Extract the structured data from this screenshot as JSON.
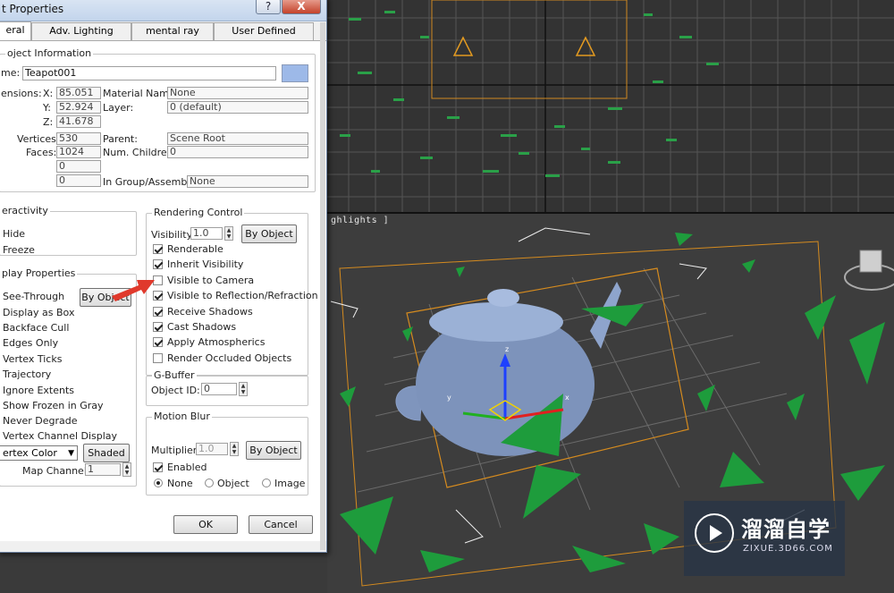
{
  "dialog": {
    "title": "t Properties",
    "help_btn": "?",
    "close_btn": "X",
    "tabs": [
      "eral",
      "Adv. Lighting",
      "mental ray",
      "User Defined"
    ],
    "object_info": {
      "group_title": "oject Information",
      "name_label": "me:",
      "name_value": "Teapot001",
      "color_swatch": "#9db9e8",
      "dimensions_label": "ensions:",
      "x_label": "X:",
      "x_value": "85.051",
      "y_label": "Y:",
      "y_value": "52.924",
      "z_label": "Z:",
      "z_value": "41.678",
      "vertices_label": "Vertices:",
      "vertices_value": "530",
      "faces_label": "Faces:",
      "faces_value": "1024",
      "extra1": "0",
      "extra2": "0",
      "material_name_label": "Material Name:",
      "material_name_value": "None",
      "layer_label": "Layer:",
      "layer_value": "0 (default)",
      "parent_label": "Parent:",
      "parent_value": "Scene Root",
      "num_children_label": "Num. Children:",
      "num_children_value": "0",
      "group_assembly_label": "In Group/Assembly:",
      "group_assembly_value": "None"
    },
    "interactivity": {
      "group_title": "eractivity",
      "hide": "Hide",
      "freeze": "Freeze"
    },
    "display_props": {
      "group_title": "play Properties",
      "items": [
        "See-Through",
        "Display as Box",
        "Backface Cull",
        "Edges Only",
        "Vertex Ticks",
        "Trajectory",
        "Ignore Extents",
        "Show Frozen in Gray",
        "Never Degrade",
        "Vertex Channel Display"
      ],
      "by_object": "By Object",
      "vertex_color": "ertex Color",
      "shaded": "Shaded",
      "map_channel_label": "Map Channel:",
      "map_channel_value": "1"
    },
    "rendering_control": {
      "group_title": "Rendering Control",
      "visibility_label": "Visibility:",
      "visibility_value": "1.0",
      "by_object": "By Object",
      "options": [
        {
          "label": "Renderable",
          "checked": true
        },
        {
          "label": "Inherit Visibility",
          "checked": true
        },
        {
          "label": "Visible to Camera",
          "checked": false
        },
        {
          "label": "Visible to Reflection/Refraction",
          "checked": true
        },
        {
          "label": "Receive Shadows",
          "checked": true
        },
        {
          "label": "Cast Shadows",
          "checked": true
        },
        {
          "label": "Apply Atmospherics",
          "checked": true
        },
        {
          "label": "Render Occluded Objects",
          "checked": false
        }
      ]
    },
    "gbuffer": {
      "group_title": "G-Buffer",
      "object_id_label": "Object ID:",
      "object_id_value": "0"
    },
    "motion_blur": {
      "group_title": "Motion Blur",
      "multiplier_label": "Multiplier:",
      "multiplier_value": "1.0",
      "by_object": "By Object",
      "enabled": "Enabled",
      "none": "None",
      "object": "Object",
      "image": "Image"
    },
    "ok": "OK",
    "cancel": "Cancel"
  },
  "viewport": {
    "label": "ghlights ]",
    "gizmo_x": "x",
    "gizmo_y": "y",
    "gizmo_z": "z"
  },
  "watermark": {
    "cn": "溜溜自学",
    "en": "ZIXUE.3D66.COM"
  }
}
